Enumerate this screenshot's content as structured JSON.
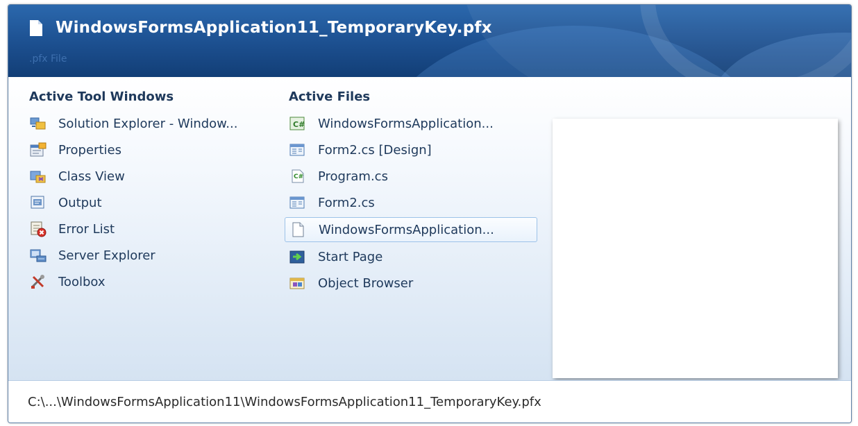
{
  "header": {
    "title": "WindowsFormsApplication11_TemporaryKey.pfx",
    "subtitle": ".pfx File",
    "icon": "document-icon"
  },
  "tool_windows": {
    "heading": "Active Tool Windows",
    "items": [
      {
        "label": "Solution Explorer - Window...",
        "icon": "solution-explorer-icon"
      },
      {
        "label": "Properties",
        "icon": "properties-icon"
      },
      {
        "label": "Class View",
        "icon": "class-view-icon"
      },
      {
        "label": "Output",
        "icon": "output-icon"
      },
      {
        "label": "Error List",
        "icon": "error-list-icon"
      },
      {
        "label": "Server Explorer",
        "icon": "server-explorer-icon"
      },
      {
        "label": "Toolbox",
        "icon": "toolbox-icon"
      }
    ]
  },
  "active_files": {
    "heading": "Active Files",
    "selected_index": 4,
    "items": [
      {
        "label": "WindowsFormsApplication...",
        "icon": "csharp-project-icon"
      },
      {
        "label": "Form2.cs [Design]",
        "icon": "form-design-icon"
      },
      {
        "label": "Program.cs",
        "icon": "csharp-file-icon"
      },
      {
        "label": "Form2.cs",
        "icon": "form-design-icon"
      },
      {
        "label": "WindowsFormsApplication...",
        "icon": "document-icon"
      },
      {
        "label": "Start Page",
        "icon": "start-page-icon"
      },
      {
        "label": "Object Browser",
        "icon": "object-browser-icon"
      }
    ]
  },
  "status": {
    "path": "C:\\...\\WindowsFormsApplication11\\WindowsFormsApplication11_TemporaryKey.pfx"
  },
  "colors": {
    "header_top": "#2b68ad",
    "header_bottom": "#123e76",
    "text": "#1e395b",
    "selection_border": "#9cc2e8"
  }
}
